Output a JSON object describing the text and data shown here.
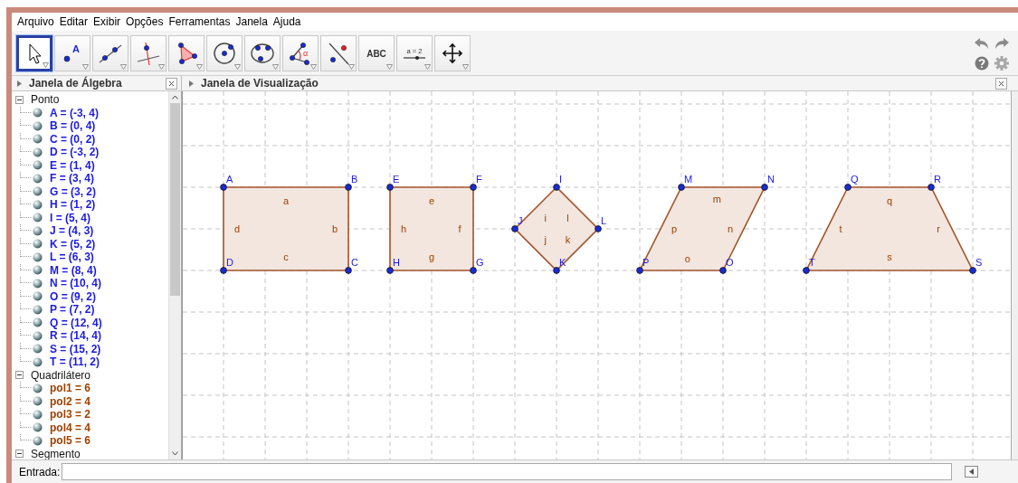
{
  "menu": [
    "Arquivo",
    "Editar",
    "Exibir",
    "Opções",
    "Ferramentas",
    "Janela",
    "Ajuda"
  ],
  "toolbar": {
    "tools": [
      {
        "kind": "move",
        "selected": true
      },
      {
        "kind": "point",
        "selected": false,
        "glyph": "A"
      },
      {
        "kind": "line",
        "selected": false
      },
      {
        "kind": "perpendicular",
        "selected": false
      },
      {
        "kind": "polygon",
        "selected": false
      },
      {
        "kind": "circle",
        "selected": false
      },
      {
        "kind": "conic",
        "selected": false
      },
      {
        "kind": "angle",
        "selected": false,
        "glyph": "α"
      },
      {
        "kind": "reflect",
        "selected": false
      },
      {
        "kind": "text",
        "selected": false,
        "glyph": "ABC"
      },
      {
        "kind": "slider",
        "selected": false,
        "glyph": "a = 2"
      },
      {
        "kind": "pan",
        "selected": false
      }
    ]
  },
  "panels": [
    {
      "title": "Janela de Álgebra"
    },
    {
      "title": "Janela de Visualização"
    }
  ],
  "algebra": {
    "groups": [
      {
        "label": "Ponto",
        "kind": "point",
        "expanded": true,
        "items": [
          "A = (-3, 4)",
          "B = (0, 4)",
          "C = (0, 2)",
          "D = (-3, 2)",
          "E = (1, 4)",
          "F = (3, 4)",
          "G = (3, 2)",
          "H = (1, 2)",
          "I = (5, 4)",
          "J = (4, 3)",
          "K = (5, 2)",
          "L = (6, 3)",
          "M = (8, 4)",
          "N = (10, 4)",
          "O = (9, 2)",
          "P = (7, 2)",
          "Q = (12, 4)",
          "R = (14, 4)",
          "S = (15, 2)",
          "T = (11, 2)"
        ]
      },
      {
        "label": "Quadrilátero",
        "kind": "polygon",
        "expanded": true,
        "items": [
          "pol1 = 6",
          "pol2 = 4",
          "pol3 = 2",
          "pol4 = 4",
          "pol5 = 6"
        ]
      },
      {
        "label": "Segmento",
        "expanded": true
      }
    ]
  },
  "canvas": {
    "polygons": [
      {
        "vertices": [
          "A",
          "B",
          "D",
          "C"
        ],
        "edges": [
          "a",
          "d",
          "b",
          "c"
        ]
      },
      {
        "vertices": [
          "E",
          "F",
          "H",
          "G"
        ],
        "edges": [
          "e",
          "h",
          "f",
          "g"
        ]
      },
      {
        "vertices": [
          "I",
          "J",
          "L",
          "K"
        ],
        "edges": [
          "i",
          "l",
          "j",
          "k"
        ]
      },
      {
        "vertices": [
          "M",
          "N",
          "P",
          "O"
        ],
        "edges": [
          "m",
          "p",
          "n",
          "o"
        ]
      },
      {
        "vertices": [
          "Q",
          "R",
          "T",
          "S"
        ],
        "edges": [
          "q",
          "t",
          "r",
          "s"
        ]
      }
    ]
  },
  "input": {
    "label": "Entrada:"
  }
}
